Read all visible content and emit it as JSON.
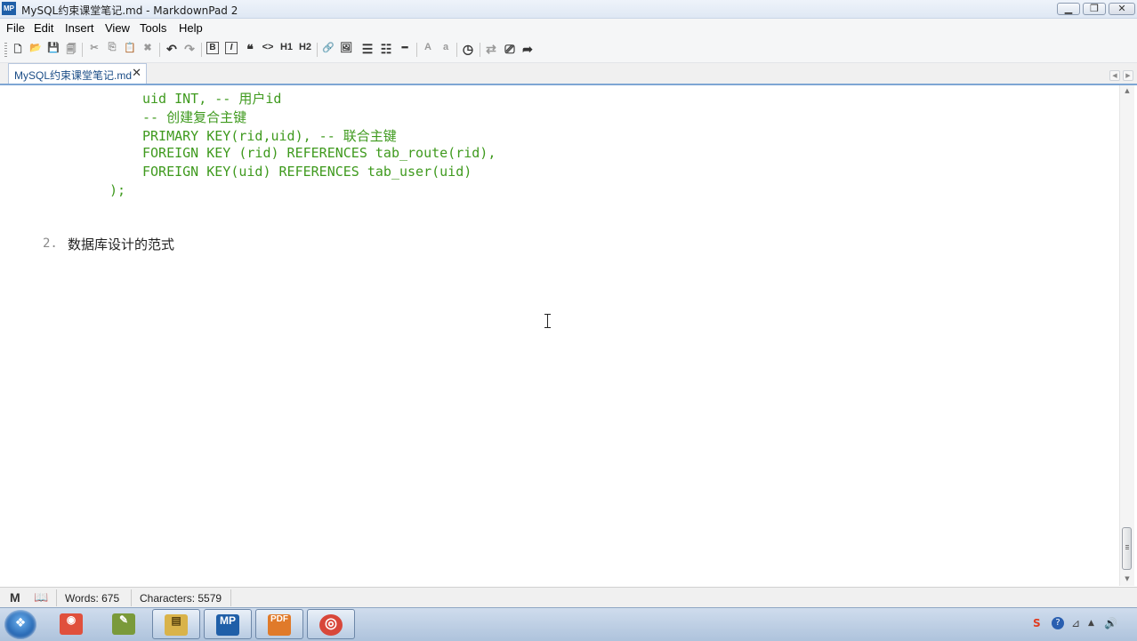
{
  "window": {
    "app_icon_text": "MP",
    "title": "MySQL约束课堂笔记.md - MarkdownPad 2",
    "controls": {
      "minimize": "▁",
      "maximize": "❐",
      "close": "✕"
    }
  },
  "menu": {
    "file": "File",
    "edit": "Edit",
    "insert": "Insert",
    "view": "View",
    "tools": "Tools",
    "help": "Help"
  },
  "toolbar": {
    "new": "🗋",
    "open": "📂",
    "save": "💾",
    "save_all": "🗐",
    "cut": "✂",
    "copy": "⎘",
    "paste": "📋",
    "delete": "✖",
    "undo": "↶",
    "redo": "↷",
    "bold": "B",
    "italic": "I",
    "quote": "❝",
    "code": "<>",
    "h1": "H1",
    "h2": "H2",
    "link": "🔗",
    "image": "🖼",
    "ul": "☰",
    "ol": "☷",
    "hr": "━",
    "font_up": "A",
    "font_down": "a",
    "timestamp": "◷",
    "preview_toggle": "⇄",
    "live_preview": "⎚",
    "export": "➦"
  },
  "tab": {
    "label": "MySQL约束课堂笔记.md",
    "close": "✕",
    "scroll_left": "◀",
    "scroll_right": "▶"
  },
  "editor": {
    "code_lines": [
      "uid INT, -- 用户id",
      "-- 创建复合主键",
      "PRIMARY KEY(rid,uid), -- 联合主键",
      "FOREIGN KEY (rid) REFERENCES tab_route(rid),",
      "FOREIGN KEY(uid) REFERENCES tab_user(uid)",
      ");"
    ],
    "list_number": "2.",
    "list_text": "数据库设计的范式"
  },
  "scrollbar": {
    "up": "▲",
    "down": "▼"
  },
  "status": {
    "markdown_icon": "M",
    "book_icon": "📖",
    "words": "Words: 675",
    "characters": "Characters: 5579"
  },
  "taskbar": {
    "start_icon": "❖",
    "apps": [
      {
        "icon": "paint-app",
        "glyph": "◉"
      },
      {
        "icon": "pencil-app",
        "glyph": "✎"
      },
      {
        "icon": "explorer-app",
        "glyph": "▤"
      },
      {
        "icon": "markdownpad-app",
        "glyph": "MP"
      },
      {
        "icon": "pdf-app",
        "glyph": "PDF"
      },
      {
        "icon": "chrome-app",
        "glyph": "◎"
      }
    ],
    "tray": {
      "ime": "S",
      "help": "?",
      "network": "⊿",
      "show_hidden": "▲",
      "volume": "🔊"
    }
  },
  "colors": {
    "code_green": "#3f9a1e",
    "tab_text": "#1a4c86",
    "accent_blue": "#7ea6d4"
  }
}
